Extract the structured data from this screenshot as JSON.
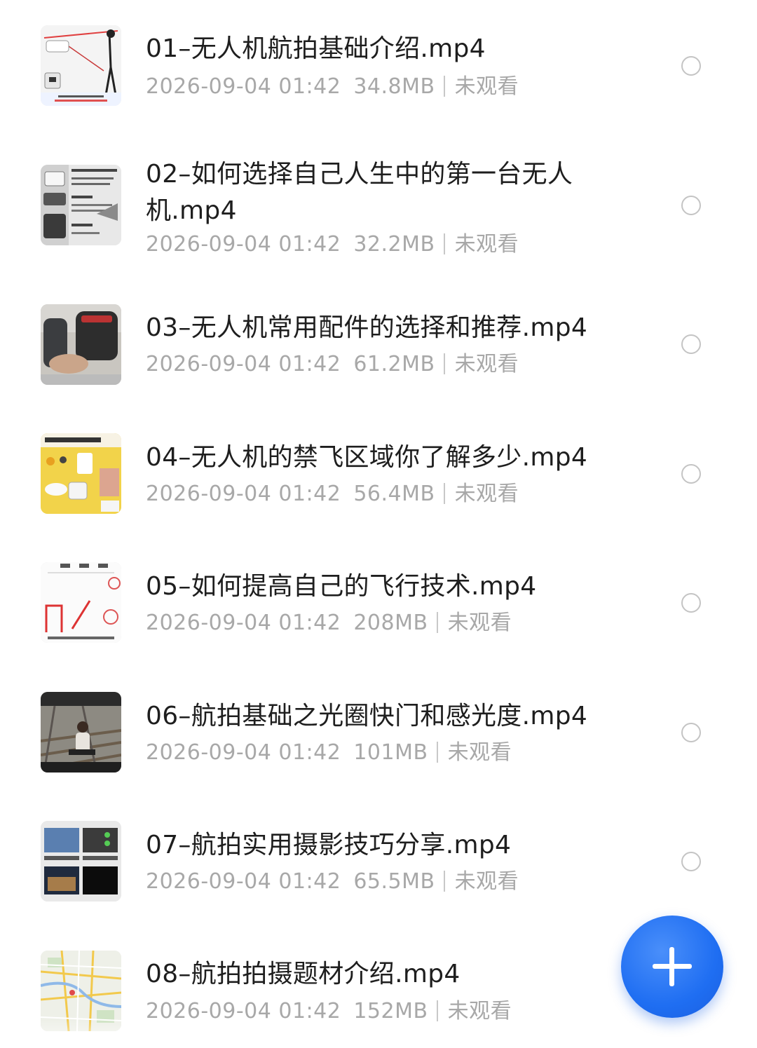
{
  "videos": [
    {
      "title": "01–无人机航拍基础介绍.mp4",
      "date": "2026-09-04 01:42",
      "size": "34.8MB",
      "status": "未观看"
    },
    {
      "title": "02–如何选择自己人生中的第一台无人机.mp4",
      "date": "2026-09-04 01:42",
      "size": "32.2MB",
      "status": "未观看"
    },
    {
      "title": "03–无人机常用配件的选择和推荐.mp4",
      "date": "2026-09-04 01:42",
      "size": "61.2MB",
      "status": "未观看"
    },
    {
      "title": "04–无人机的禁飞区域你了解多少.mp4",
      "date": "2026-09-04 01:42",
      "size": "56.4MB",
      "status": "未观看"
    },
    {
      "title": "05–如何提高自己的飞行技术.mp4",
      "date": "2026-09-04 01:42",
      "size": "208MB",
      "status": "未观看"
    },
    {
      "title": "06–航拍基础之光圈快门和感光度.mp4",
      "date": "2026-09-04 01:42",
      "size": "101MB",
      "status": "未观看"
    },
    {
      "title": "07–航拍实用摄影技巧分享.mp4",
      "date": "2026-09-04 01:42",
      "size": "65.5MB",
      "status": "未观看"
    },
    {
      "title": "08–航拍拍摄题材介绍.mp4",
      "date": "2026-09-04 01:42",
      "size": "152MB",
      "status": "未观看"
    }
  ],
  "fab": {
    "icon": "plus-icon"
  },
  "colors": {
    "accent": "#1f6ef2",
    "title": "#1e1e1e",
    "meta": "#a8a8a8",
    "radio": "#c4c4c4"
  }
}
